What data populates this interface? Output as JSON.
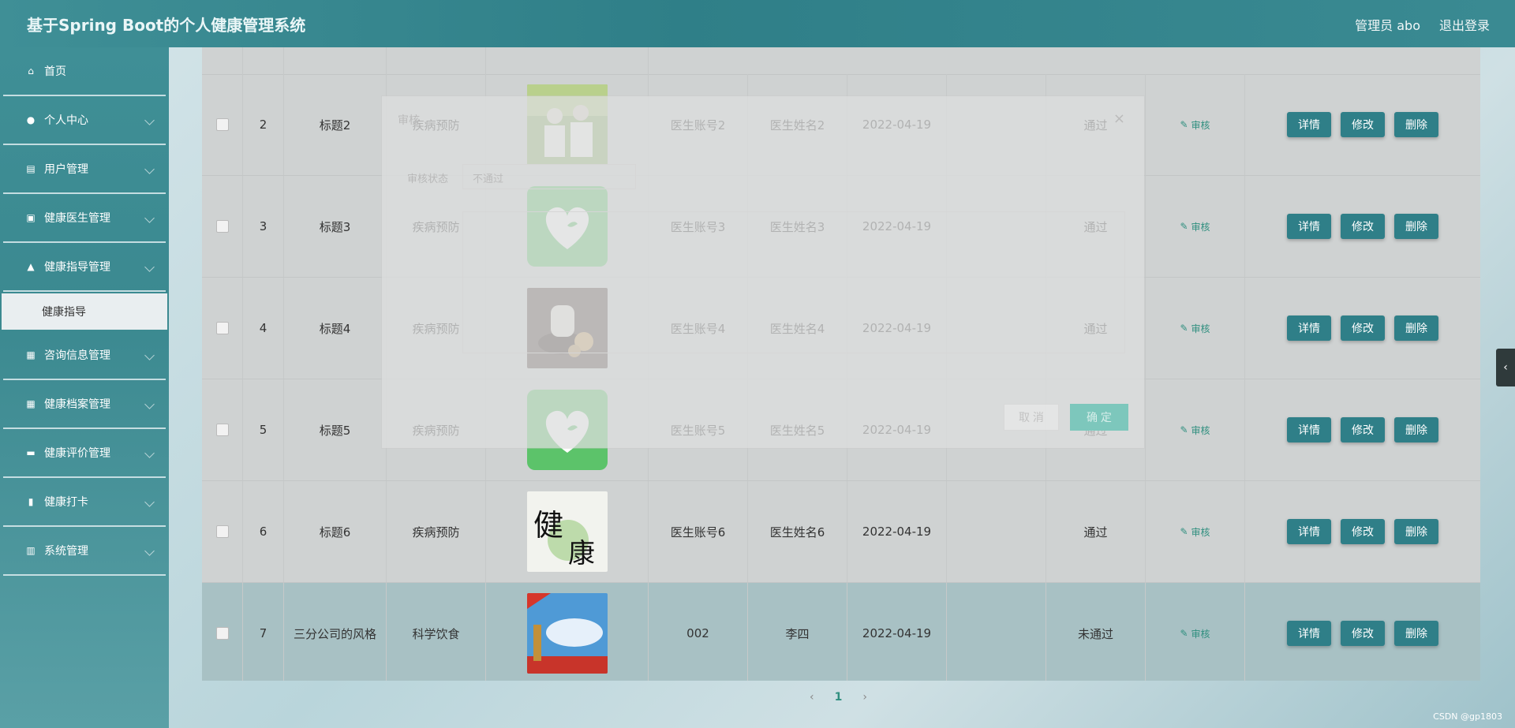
{
  "header": {
    "title": "基于Spring Boot的个人健康管理系统",
    "user": "管理员 abo",
    "logout": "退出登录"
  },
  "sidebar": {
    "items": [
      {
        "label": "首页",
        "icon": "home-icon",
        "expandable": false
      },
      {
        "label": "个人中心",
        "icon": "user-icon",
        "expandable": true
      },
      {
        "label": "用户管理",
        "icon": "doc-icon",
        "expandable": true
      },
      {
        "label": "健康医生管理",
        "icon": "case-icon",
        "expandable": true
      },
      {
        "label": "健康指导管理",
        "icon": "thumb-icon",
        "expandable": true
      },
      {
        "label": "咨询信息管理",
        "icon": "grid-icon",
        "expandable": true
      },
      {
        "label": "健康档案管理",
        "icon": "grid-icon",
        "expandable": true
      },
      {
        "label": "健康评价管理",
        "icon": "ticket-icon",
        "expandable": true
      },
      {
        "label": "健康打卡",
        "icon": "book-icon",
        "expandable": true
      },
      {
        "label": "系统管理",
        "icon": "clipboard-icon",
        "expandable": true
      }
    ],
    "active_sub": "健康指导"
  },
  "table": {
    "rows": [
      {
        "idx": "2",
        "title": "标题2",
        "type": "疾病预防",
        "account": "医生账号2",
        "name": "医生姓名2",
        "date": "2022-04-19",
        "status": "通过",
        "img": "elderly-couple"
      },
      {
        "idx": "3",
        "title": "标题3",
        "type": "疾病预防",
        "account": "医生账号3",
        "name": "医生姓名3",
        "date": "2022-04-19",
        "status": "通过",
        "img": "heart-app"
      },
      {
        "idx": "4",
        "title": "标题4",
        "type": "疾病预防",
        "account": "医生账号4",
        "name": "医生姓名4",
        "date": "2022-04-19",
        "status": "通过",
        "img": "herbal-tea"
      },
      {
        "idx": "5",
        "title": "标题5",
        "type": "疾病预防",
        "account": "医生账号5",
        "name": "医生姓名5",
        "date": "2022-04-19",
        "status": "通过",
        "img": "heart-app"
      },
      {
        "idx": "6",
        "title": "标题6",
        "type": "疾病预防",
        "account": "医生账号6",
        "name": "医生姓名6",
        "date": "2022-04-19",
        "status": "通过",
        "img": "calligraphy"
      },
      {
        "idx": "7",
        "title": "三分公司的风格",
        "type": "科学饮食",
        "account": "002",
        "name": "李四",
        "date": "2022-04-19",
        "status": "未通过",
        "img": "sky-tower"
      }
    ],
    "audit_label": "审核",
    "detail_label": "详情",
    "edit_label": "修改",
    "delete_label": "删除"
  },
  "modal": {
    "title": "审核",
    "close": "×",
    "status_label": "审核状态",
    "status_value": "不通过",
    "cancel": "取 消",
    "confirm": "确 定"
  },
  "pager": {
    "prev": "‹",
    "page": "1",
    "next": "›"
  },
  "handle": "‹",
  "watermark": "CSDN @gp1803"
}
